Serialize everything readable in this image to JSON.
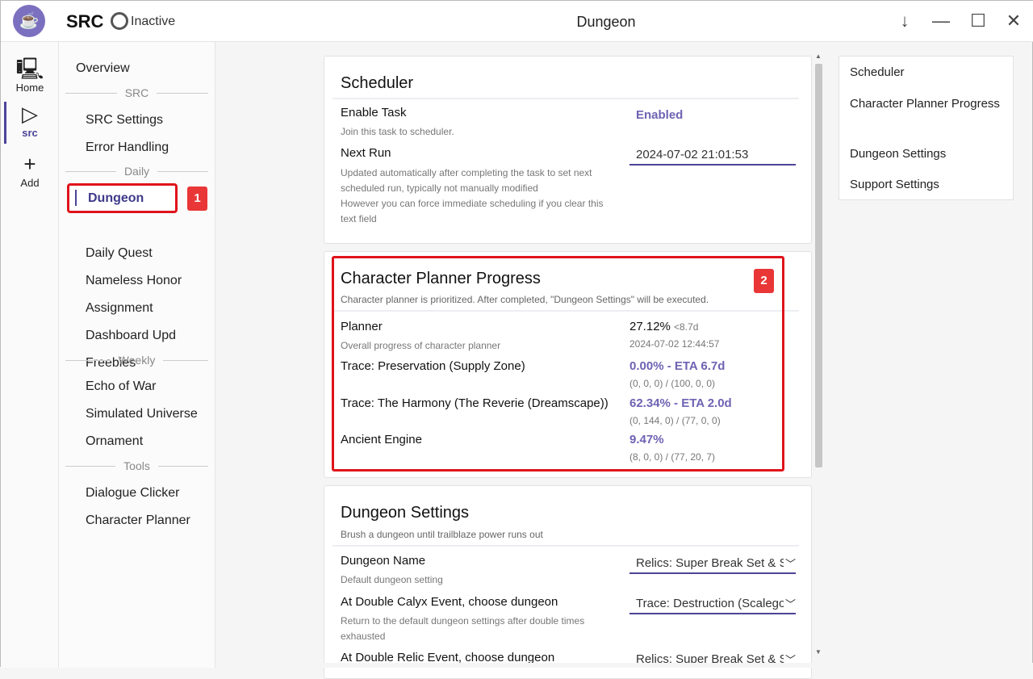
{
  "header": {
    "app_name": "SRC",
    "status": "Inactive",
    "window_title": "Dungeon",
    "logo_icon": "coffee-cup-icon"
  },
  "rail": [
    {
      "label": "Home",
      "icon": "code-monitor-icon"
    },
    {
      "label": "src",
      "icon": "play-icon"
    },
    {
      "label": "Add",
      "icon": "plus-icon"
    }
  ],
  "nav": {
    "overview": "Overview",
    "sections": [
      "SRC",
      "Daily",
      "Weekly",
      "Tools"
    ],
    "src_items": [
      "SRC Settings",
      "Error Handling"
    ],
    "daily_items": [
      "Dungeon",
      "Daily Quest",
      "Nameless Honor",
      "Assignment",
      "Dashboard Upd",
      "Freebies"
    ],
    "weekly_items": [
      "Echo of War",
      "Simulated Universe",
      "Ornament"
    ],
    "tools_items": [
      "Dialogue Clicker",
      "Character Planner"
    ]
  },
  "annotations": [
    "1",
    "2"
  ],
  "scheduler": {
    "title": "Scheduler",
    "enable_label": "Enable Task",
    "enable_desc": "Join this task to scheduler.",
    "enable_value": "Enabled",
    "next_label": "Next Run",
    "next_desc1": "Updated automatically after completing the task to set next",
    "next_desc2": "scheduled run, typically not manually modified",
    "next_desc3": "However you can force immediate scheduling if you clear this",
    "next_desc4": "text field",
    "next_value": "2024-07-02 21:01:53"
  },
  "planner": {
    "title": "Character Planner Progress",
    "subtitle": "Character planner is prioritized. After completed, \"Dungeon Settings\" will be executed.",
    "rows": [
      {
        "label": "Planner",
        "desc": "Overall progress of character planner",
        "value": "27.12%",
        "extra": "<8.7d",
        "sub": "2024-07-02 12:44:57"
      },
      {
        "label": "Trace: Preservation (Supply Zone)",
        "value": "0.00% - ETA 6.7d",
        "sub": "(0, 0, 0) / (100, 0, 0)"
      },
      {
        "label": "Trace: The Harmony (The Reverie (Dreamscape))",
        "value": "62.34% - ETA 2.0d",
        "sub": "(0, 144, 0) / (77, 0, 0)"
      },
      {
        "label": "Ancient Engine",
        "value": "9.47%",
        "sub": "(8, 0, 0) / (77, 20, 7)"
      }
    ]
  },
  "dungeon": {
    "title": "Dungeon Settings",
    "subtitle": "Brush a dungeon until trailblaze power runs out",
    "name_label": "Dungeon Name",
    "name_desc": "Default dungeon setting",
    "name_value": "Relics: Super Break Set & Sprightly",
    "calyx_label": "At Double Calyx Event, choose dungeon",
    "calyx_desc1": "Return to the default dungeon settings after double times",
    "calyx_desc2": "exhausted",
    "calyx_value": "Trace: Destruction (Scalegorge Waterscape)",
    "relic_label": "At Double Relic Event, choose dungeon",
    "relic_value": "Relics: Super Break Set & Sprightly"
  },
  "toc": [
    "Scheduler",
    "Character Planner Progress",
    "Dungeon Settings",
    "Support Settings"
  ],
  "colors": {
    "accent": "#4b4497",
    "value_purple": "#6e63b3",
    "highlight_red": "#e0131b"
  }
}
